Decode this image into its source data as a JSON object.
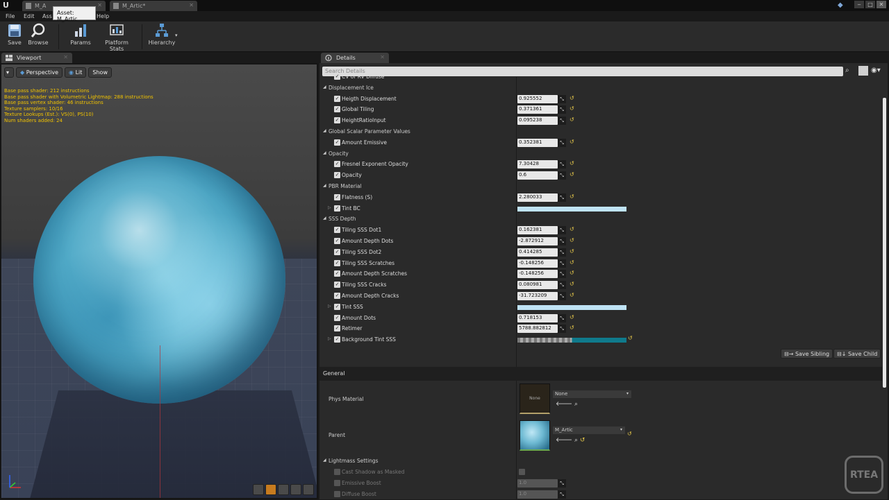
{
  "tabs": {
    "tab1": "M_A",
    "tab2": "M_Artic*",
    "tooltip": "Asset: M_Artic"
  },
  "menu": [
    "File",
    "Edit",
    "Ass",
    "Help"
  ],
  "toolbar": {
    "save": "Save",
    "browse": "Browse",
    "params": "Params",
    "platform_stats": "Platform Stats",
    "hierarchy": "Hierarchy"
  },
  "viewport": {
    "tab_label": "Viewport",
    "perspective": "Perspective",
    "lit": "Lit",
    "show": "Show",
    "stats": [
      "Base pass shader: 212 instructions",
      "Base pass shader with Volumetric Lightmap: 288 instructions",
      "Base pass vertex shader: 46 instructions",
      "Texture samplers: 10/16",
      "Texture Lookups (Est.): VS(0), PS(10)",
      "Num shaders added: 24"
    ]
  },
  "details": {
    "tab_label": "Details",
    "search_placeholder": "Search Details",
    "rows": [
      {
        "type": "param",
        "label": "CV or RV Diffuse",
        "value": ""
      },
      {
        "type": "cat",
        "label": "Displacement Ice"
      },
      {
        "type": "param",
        "label": "Heigth Displacement",
        "value": "0.925552"
      },
      {
        "type": "param",
        "label": "Global Tiling",
        "value": "0.371361"
      },
      {
        "type": "param",
        "label": "HeightRatioInput",
        "value": "0.095238"
      },
      {
        "type": "cat",
        "label": "Global Scalar Parameter Values"
      },
      {
        "type": "param",
        "label": "Amount Emissive",
        "value": "0.352381"
      },
      {
        "type": "cat",
        "label": "Opacity"
      },
      {
        "type": "param",
        "label": "Fresnel Exponent Opacity",
        "value": "7.30428"
      },
      {
        "type": "param",
        "label": "Opacity",
        "value": "0.6"
      },
      {
        "type": "cat",
        "label": "PBR Material"
      },
      {
        "type": "param",
        "label": "Flatness (S)",
        "value": "2.280033"
      },
      {
        "type": "color",
        "label": "Tint BC",
        "color": "#bfe3f5"
      },
      {
        "type": "cat",
        "label": "SSS Depth"
      },
      {
        "type": "param",
        "label": "Tiling SSS Dot1",
        "value": "0.162381"
      },
      {
        "type": "param",
        "label": "Amount Depth Dots",
        "value": "-2.872912"
      },
      {
        "type": "param",
        "label": "Tiling SSS Dot2",
        "value": "0.414285"
      },
      {
        "type": "param",
        "label": "Tiling SSS Scratches",
        "value": "-0.148256"
      },
      {
        "type": "param",
        "label": "Amount Depth Scratches",
        "value": "-0.148256"
      },
      {
        "type": "param",
        "label": "Tiling SSS Cracks",
        "value": "0.080981"
      },
      {
        "type": "param",
        "label": "Amount Depth Cracks",
        "value": "-31.723209"
      },
      {
        "type": "color",
        "label": "Tint SSS",
        "color": "#bfe3f5"
      },
      {
        "type": "param",
        "label": "Amount Dots",
        "value": "0.718153"
      },
      {
        "type": "param",
        "label": "Retimer",
        "value": "5788.882812"
      },
      {
        "type": "color",
        "label": "Background Tint SSS",
        "color": "#0f7a8c"
      }
    ],
    "save_sibling": "Save Sibling",
    "save_child": "Save Child",
    "general": {
      "header": "General",
      "phys_material_label": "Phys Material",
      "phys_material_thumb": "None",
      "phys_material_value": "None",
      "parent_label": "Parent",
      "parent_value": "M_Artic"
    },
    "lightmass": {
      "header": "Lightmass Settings",
      "rows": [
        {
          "label": "Cast Shadow as Masked",
          "value": ""
        },
        {
          "label": "Emissive Boost",
          "value": "1.0"
        },
        {
          "label": "Diffuse Boost",
          "value": "1.0"
        }
      ]
    }
  },
  "watermark": "RTEA"
}
